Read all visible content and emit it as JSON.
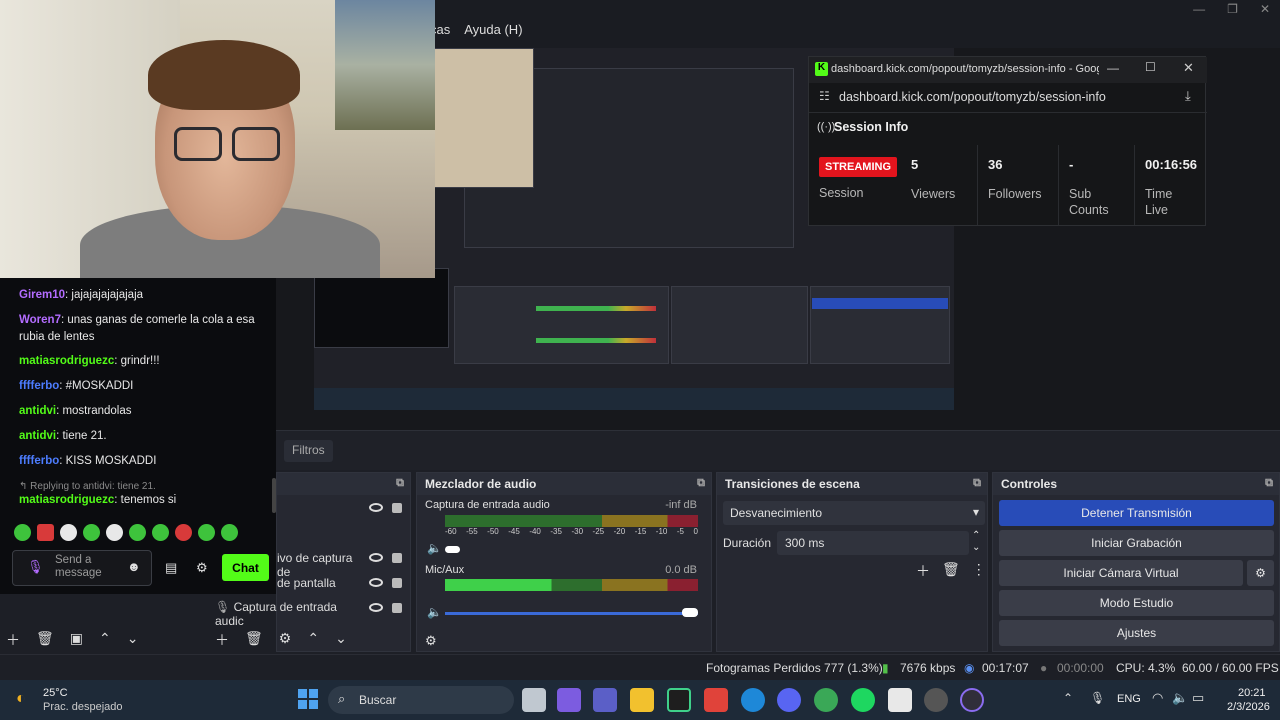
{
  "obs": {
    "menu": [
      "cas",
      "Ayuda (H)"
    ],
    "filters_tab": "Filtros",
    "sources": [
      "ivo de captura de",
      "de pantalla",
      "Captura de entrada audic"
    ],
    "mixer": {
      "title": "Mezclador de audio",
      "ch1_name": "Captura de entrada audio",
      "ch1_db": "-inf dB",
      "ch2_name": "Mic/Aux",
      "ch2_db": "0.0 dB",
      "scale": [
        "-60",
        "-55",
        "-50",
        "-45",
        "-40",
        "-35",
        "-30",
        "-25",
        "-20",
        "-15",
        "-10",
        "-5",
        "0"
      ]
    },
    "transitions": {
      "title": "Transiciones de escena",
      "selected": "Desvanecimiento",
      "duration_label": "Duración",
      "duration_value": "300 ms"
    },
    "controls": {
      "title": "Controles",
      "stop_stream": "Detener Transmisión",
      "start_recording": "Iniciar Grabación",
      "start_virtual_cam": "Iniciar Cámara Virtual",
      "studio_mode": "Modo Estudio",
      "settings": "Ajustes"
    },
    "status": {
      "dropped": "Fotogramas Perdidos 777 (1.3%)",
      "kbps": "7676 kbps",
      "live_time": "00:17:07",
      "rec_time": "00:00:00",
      "cpu": "CPU: 4.3%",
      "fps": "60.00 / 60.00 FPS"
    }
  },
  "chat": {
    "messages": [
      {
        "user": "Girem10",
        "color": "#b36cff",
        "text": "jajajajajajajaja"
      },
      {
        "user": "Woren7",
        "color": "#b36cff",
        "text": "unas ganas de comerle la cola a esa rubia de lentes"
      },
      {
        "user": "matiasrodriguezc",
        "color": "#53fc18",
        "text": "grindr!!!"
      },
      {
        "user": "fffferbo",
        "color": "#4d7dff",
        "text": "#MOSKADDI"
      },
      {
        "user": "antidvi",
        "color": "#53fc18",
        "text": "mostrandolas"
      },
      {
        "user": "antidvi",
        "color": "#53fc18",
        "text": "tiene 21."
      },
      {
        "user": "fffferbo",
        "color": "#4d7dff",
        "text": "KISS MOSKADDI"
      },
      {
        "user": "matiasrodriguezc",
        "color": "#53fc18",
        "text": "tenemos si"
      }
    ],
    "reply_hint": "Replying to antidvi: tiene 21.",
    "placeholder": "Send a message",
    "chat_button": "Chat"
  },
  "popout": {
    "window_title": "dashboard.kick.com/popout/tomyzb/session-info - Googl...",
    "url": "dashboard.kick.com/popout/tomyzb/session-info",
    "section_title": "Session Info",
    "badge": "STREAMING",
    "session_label": "Session",
    "viewers_value": "5",
    "viewers_label": "Viewers",
    "followers_value": "36",
    "followers_label": "Followers",
    "subs_value": "-",
    "subs_label": "Sub Counts",
    "time_value": "00:16:56",
    "time_label": "Time Live"
  },
  "taskbar": {
    "weather_temp": "25°C",
    "weather_desc": "Prac. despejado",
    "search": "Buscar",
    "lang": "ENG",
    "time": "20:21",
    "date": "2/3/2026"
  }
}
